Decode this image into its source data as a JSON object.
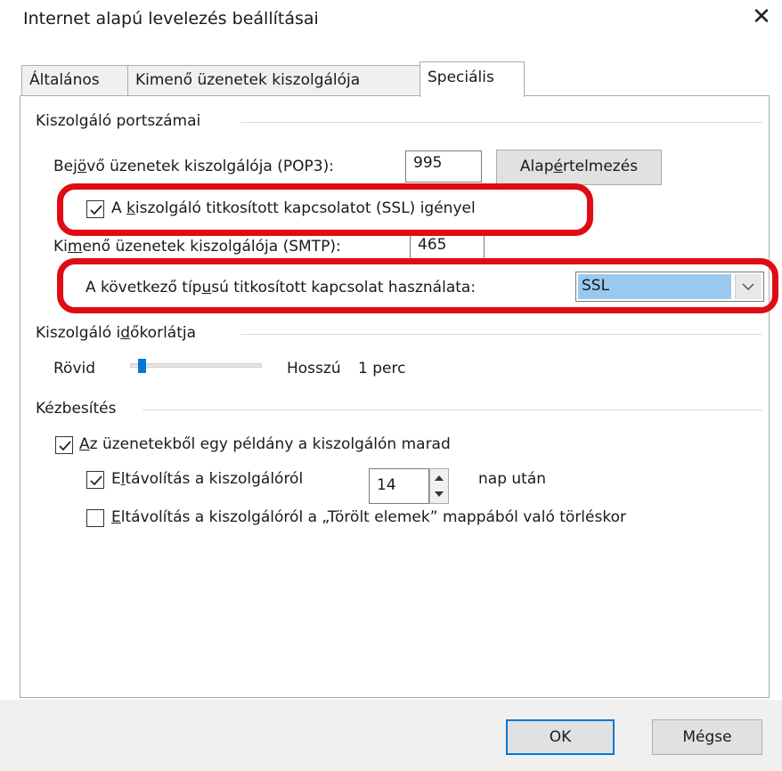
{
  "window": {
    "title": "Internet alapú levelezés beállításai",
    "close_glyph": "✕"
  },
  "tabs": [
    {
      "label": "Általános",
      "active": false
    },
    {
      "label": "Kimenő üzenetek kiszolgálója",
      "active": false
    },
    {
      "label": "Speciális",
      "active": true
    }
  ],
  "ports": {
    "group_label": "Kiszolgáló portszámai",
    "incoming_label_pre": "Bej",
    "incoming_label_u": "ö",
    "incoming_label_post": "vő üzenetek kiszolgálója (POP3):",
    "incoming_value": "995",
    "default_button_pre": "Alap",
    "default_button_u": "é",
    "default_button_post": "rtelmezés",
    "ssl_checkbox_pre": "A ",
    "ssl_checkbox_u": "k",
    "ssl_checkbox_post": "iszolgáló titkosított kapcsolatot (SSL) igényel",
    "ssl_checked": true,
    "outgoing_label_pre": "Ki",
    "outgoing_label_u": "m",
    "outgoing_label_post": "enő üzenetek kiszolgálója (SMTP):",
    "outgoing_value": "465",
    "encryption_label_pre": "A következő típ",
    "encryption_label_u": "u",
    "encryption_label_post": "sú titkosított kapcsolat használata:",
    "encryption_value": "SSL"
  },
  "timeout": {
    "group_label_pre": "Kiszolgáló i",
    "group_label_u": "d",
    "group_label_post": "őkorlátja",
    "short_label": "Rövid",
    "long_label": "Hosszú",
    "value_text": "1 perc",
    "slider_fraction": 0.06
  },
  "delivery": {
    "group_label": "Kézbesítés",
    "keep_copy_u": "A",
    "keep_copy_post": "z üzenetekből egy példány a kiszolgálón marad",
    "keep_copy_checked": true,
    "remove_after_pre": "E",
    "remove_after_u": "l",
    "remove_after_post": "távolítás a kiszolgálóról",
    "remove_after_checked": true,
    "days_value": "14",
    "days_suffix": "nap után",
    "remove_deleted_u": "E",
    "remove_deleted_post": "ltávolítás a kiszolgálóról a „Törölt elemek” mappából való törléskor",
    "remove_deleted_checked": false
  },
  "buttons": {
    "ok": "OK",
    "cancel": "Mégse"
  },
  "colors": {
    "highlight_ring": "#e00b14",
    "selection": "#99c9ef",
    "accent": "#0078d7"
  }
}
